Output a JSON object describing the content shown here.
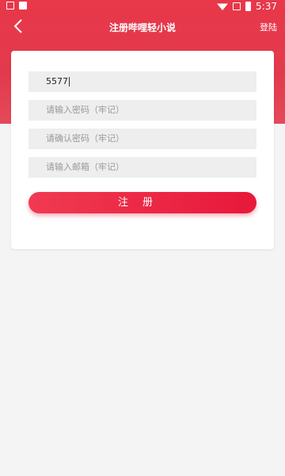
{
  "status_bar": {
    "time": "5:37"
  },
  "header": {
    "title": "注册哔哩轻小说",
    "login_label": "登陆"
  },
  "form": {
    "username_value": "5577",
    "password_placeholder": "请输入密码（牢记）",
    "confirm_placeholder": "请确认密码（牢记）",
    "email_placeholder": "请输入邮箱（牢记）",
    "register_label": "注册"
  }
}
